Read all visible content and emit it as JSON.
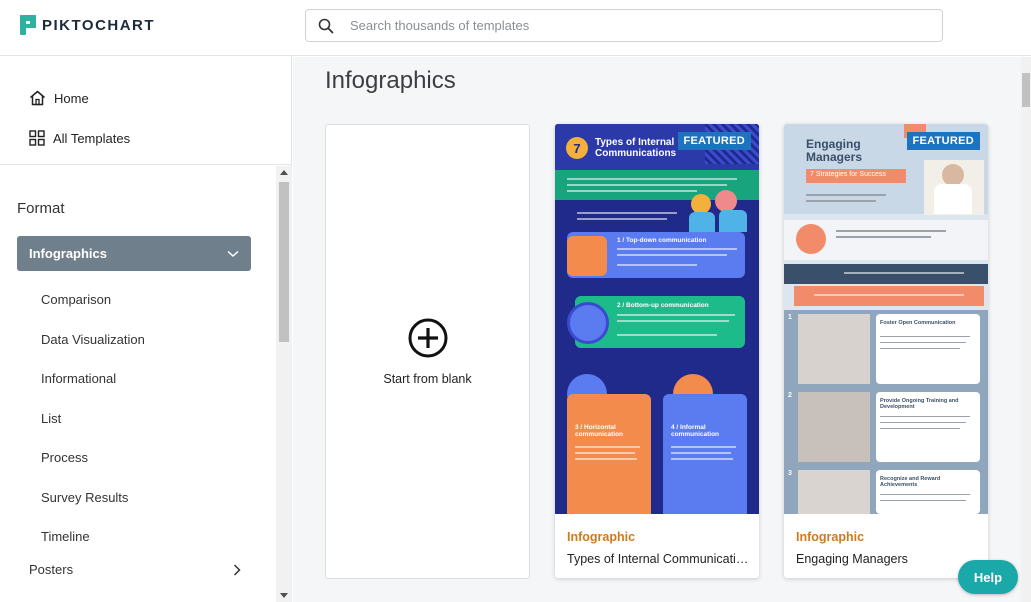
{
  "header": {
    "logo_text": "PIKTOCHART",
    "search_placeholder": "Search thousands of templates"
  },
  "sidebar": {
    "nav": [
      {
        "label": "Home",
        "icon": "home-icon"
      },
      {
        "label": "All Templates",
        "icon": "grid-icon"
      }
    ],
    "format_title": "Format",
    "active_category": "Infographics",
    "subcategories": [
      "Comparison",
      "Data Visualization",
      "Informational",
      "List",
      "Process",
      "Survey Results",
      "Timeline"
    ],
    "next_category": "Posters"
  },
  "main": {
    "title": "Infographics",
    "blank_label": "Start from blank",
    "templates": [
      {
        "badge": "FEATURED",
        "category": "Infographic",
        "name": "Types of Internal Communications",
        "thumb": {
          "number": "7",
          "heading": "Types of Internal Communications",
          "s1": "1 / Top-down communication",
          "s2": "2 / Bottom-up communication",
          "s3": "3 / Horizontal communication",
          "s4": "4 / Informal communication"
        }
      },
      {
        "badge": "FEATURED",
        "category": "Infographic",
        "name": "Engaging Managers",
        "thumb": {
          "heading": "Engaging Managers",
          "subheading": "7 Strategies for Success",
          "s1": "Foster Open Communication",
          "s2": "Provide Ongoing Training and Development",
          "s3": "Recognize and Reward Achievements",
          "n1": "1",
          "n2": "2",
          "n3": "3"
        }
      }
    ]
  },
  "help_label": "Help",
  "colors": {
    "active_category_bg": "#6f7f8c",
    "category_text": "#d07a1a",
    "featured_bg": "#1e73be",
    "help_bg": "#1aa8a8",
    "brand_teal": "#2bb3a0"
  }
}
